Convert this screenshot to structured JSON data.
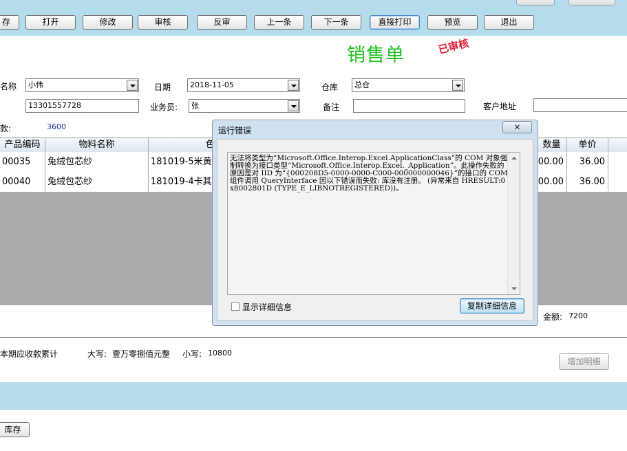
{
  "toolbar": {
    "buttons": [
      "存",
      "打开",
      "修改",
      "审核",
      "反审",
      "上一条",
      "下一条",
      "直接打印",
      "预览",
      "退出"
    ]
  },
  "header": {
    "title": "销售单",
    "status_stamp": "已审核",
    "customer_label": "名称",
    "customer_value": "小伟",
    "date_label": "日期",
    "date_value": "2018-11-05",
    "warehouse_label": "仓库",
    "warehouse_value": "总仓",
    "phone_value": "13301557728",
    "salesperson_label": "业务员:",
    "salesperson_value": "张",
    "remark_label": "备注",
    "remark_value": "",
    "address_label": "客户地址",
    "address_value": "",
    "payment_label": "款:",
    "payment_value": "3600"
  },
  "grid": {
    "columns": [
      "产品编码",
      "物料名称",
      "色",
      "数量",
      "单价"
    ],
    "rows": [
      {
        "code": "00035",
        "name": "兔绒包芯纱",
        "color": "181019-5米黄",
        "qty": "00.00",
        "price": "36.00"
      },
      {
        "code": "00040",
        "name": "兔绒包芯纱",
        "color": "181019-4卡其",
        "qty": "00.00",
        "price": "36.00"
      }
    ]
  },
  "footer": {
    "amount_label": "金额:",
    "amount_value": "7200",
    "receivable_label": "本期应收款累计",
    "upper_label": "大写:",
    "upper_value": "壹万零捌佰元整",
    "lower_label": "小写:",
    "lower_value": "10800",
    "add_detail_label": "增加明细",
    "stock_label": "库存"
  },
  "dialog": {
    "title": "运行错误",
    "close_glyph": "✕",
    "message": "无法将类型为“Microsoft.Office.Interop.Excel.ApplicationClass”的 COM 对象强制转换为接口类型“Microsoft.Office.Interop.Excel._Application”。此操作失败的原因是对 IID 为“{000208D5-0000-0000-C000-000000000046}”的接口的 COM 组件调用 QueryInterface 因以下错误而失败: 库没有注册。 (异常来自 HRESULT:0x8002801D (TYPE_E_LIBNOTREGISTERED))。",
    "show_details_label": "显示详细信息",
    "copy_details_label": "复制详细信息"
  }
}
